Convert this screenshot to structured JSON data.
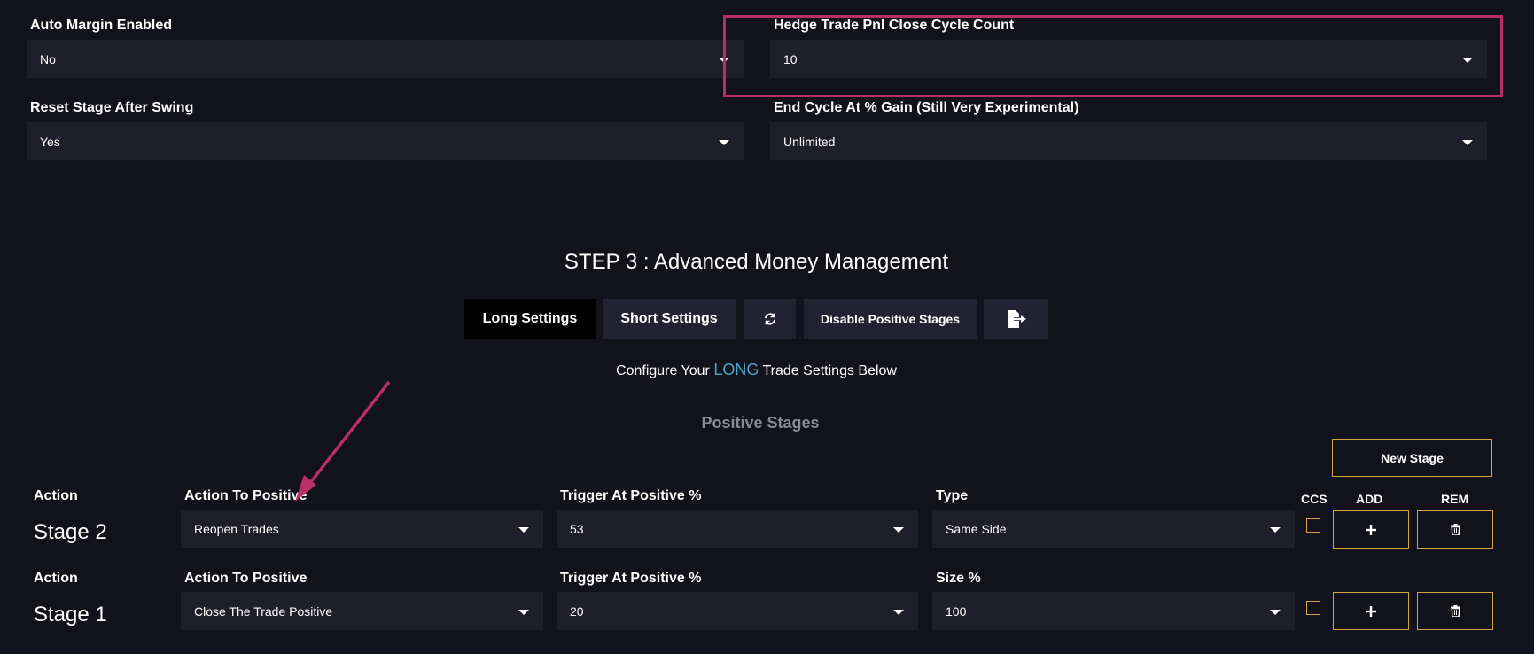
{
  "settings": {
    "auto_margin": {
      "label": "Auto Margin Enabled",
      "value": "No"
    },
    "hedge_close_count": {
      "label": "Hedge Trade Pnl Close Cycle Count",
      "value": "10"
    },
    "reset_stage": {
      "label": "Reset Stage After Swing",
      "value": "Yes"
    },
    "end_cycle": {
      "label": "End Cycle At % Gain (Still Very Experimental)",
      "value": "Unlimited"
    }
  },
  "step": {
    "title": "STEP 3 : Advanced Money Management",
    "tabs": {
      "long": "Long Settings",
      "short": "Short Settings",
      "disable_positive": "Disable Positive Stages"
    },
    "subtitle_prefix": "Configure Your",
    "subtitle_accent": "LONG",
    "subtitle_suffix": "Trade Settings Below",
    "section_title": "Positive Stages",
    "new_stage_label": "New Stage"
  },
  "stage_headers": {
    "ccs": "CCS",
    "add": "ADD",
    "rem": "REM"
  },
  "stages": [
    {
      "action_label": "Action",
      "name": "Stage 2",
      "action_to_positive": {
        "label": "Action To Positive",
        "value": "Reopen Trades"
      },
      "trigger": {
        "label": "Trigger At Positive %",
        "value": "53"
      },
      "third": {
        "label": "Type",
        "value": "Same Side"
      }
    },
    {
      "action_label": "Action",
      "name": "Stage 1",
      "action_to_positive": {
        "label": "Action To Positive",
        "value": "Close The Trade Positive"
      },
      "trigger": {
        "label": "Trigger At Positive %",
        "value": "20"
      },
      "third": {
        "label": "Size %",
        "value": "100"
      }
    }
  ],
  "colors": {
    "background": "#12121c",
    "field": "#1f1f2b",
    "accent": "#4aa3c9",
    "gold": "#d4a53a",
    "annotation": "#b82f66"
  },
  "icons": {
    "refresh": "refresh-icon",
    "export": "file-export-icon",
    "add": "plus-icon",
    "remove": "trash-icon"
  }
}
